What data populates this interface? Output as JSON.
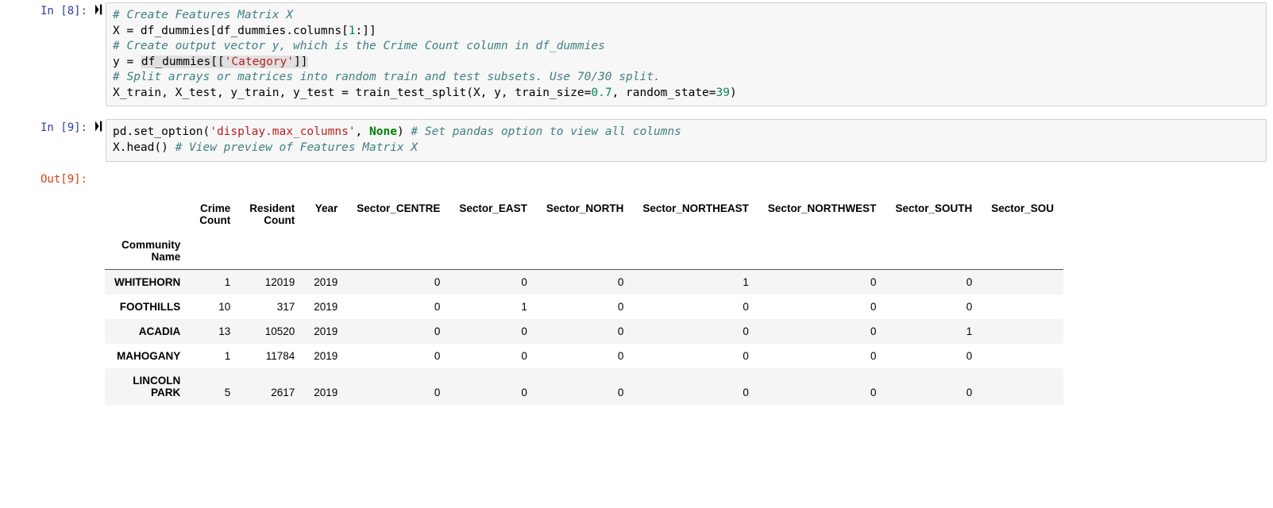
{
  "cells": {
    "c8": {
      "in_prompt": "In [8]:",
      "lines": {
        "l0_comment": "# Create Features Matrix X",
        "l1_a": "X = df_dummies[df_dummies.columns[",
        "l1_num": "1",
        "l1_b": ":]]",
        "l2_comment": "# Create output vector y, which is the Crime Count column in df_dummies",
        "l3_a": "y = ",
        "l3_hl_a": "df_dummies[[",
        "l3_str": "'Category'",
        "l3_hl_b": "]]",
        "l4_comment": "# Split arrays or matrices into random train and test subsets. Use 70/30 split.",
        "l5_a": "X_train, X_test, y_train, y_test = train_test_split(X, y, train_size=",
        "l5_n1": "0.7",
        "l5_b": ", random_state=",
        "l5_n2": "39",
        "l5_c": ")"
      }
    },
    "c9": {
      "in_prompt": "In [9]:",
      "out_prompt": "Out[9]:",
      "lines": {
        "l0_a": "pd.set_option(",
        "l0_str": "'display.max_columns'",
        "l0_b": ", ",
        "l0_kw": "None",
        "l0_c": ") ",
        "l0_comment": "# Set pandas option to view all columns",
        "l1_a": "X.head() ",
        "l1_comment": "# View preview of Features Matrix X"
      }
    }
  },
  "table": {
    "index_name": "Community\nName",
    "columns": [
      "Crime\nCount",
      "Resident\nCount",
      "Year",
      "Sector_CENTRE",
      "Sector_EAST",
      "Sector_NORTH",
      "Sector_NORTHEAST",
      "Sector_NORTHWEST",
      "Sector_SOUTH",
      "Sector_SOU"
    ],
    "rows": [
      {
        "idx": "WHITEHORN",
        "vals": [
          "1",
          "12019",
          "2019",
          "0",
          "0",
          "0",
          "1",
          "0",
          "0",
          ""
        ]
      },
      {
        "idx": "FOOTHILLS",
        "vals": [
          "10",
          "317",
          "2019",
          "0",
          "1",
          "0",
          "0",
          "0",
          "0",
          ""
        ]
      },
      {
        "idx": "ACADIA",
        "vals": [
          "13",
          "10520",
          "2019",
          "0",
          "0",
          "0",
          "0",
          "0",
          "1",
          ""
        ]
      },
      {
        "idx": "MAHOGANY",
        "vals": [
          "1",
          "11784",
          "2019",
          "0",
          "0",
          "0",
          "0",
          "0",
          "0",
          ""
        ]
      },
      {
        "idx": "LINCOLN\nPARK",
        "vals": [
          "5",
          "2617",
          "2019",
          "0",
          "0",
          "0",
          "0",
          "0",
          "0",
          ""
        ]
      }
    ]
  }
}
